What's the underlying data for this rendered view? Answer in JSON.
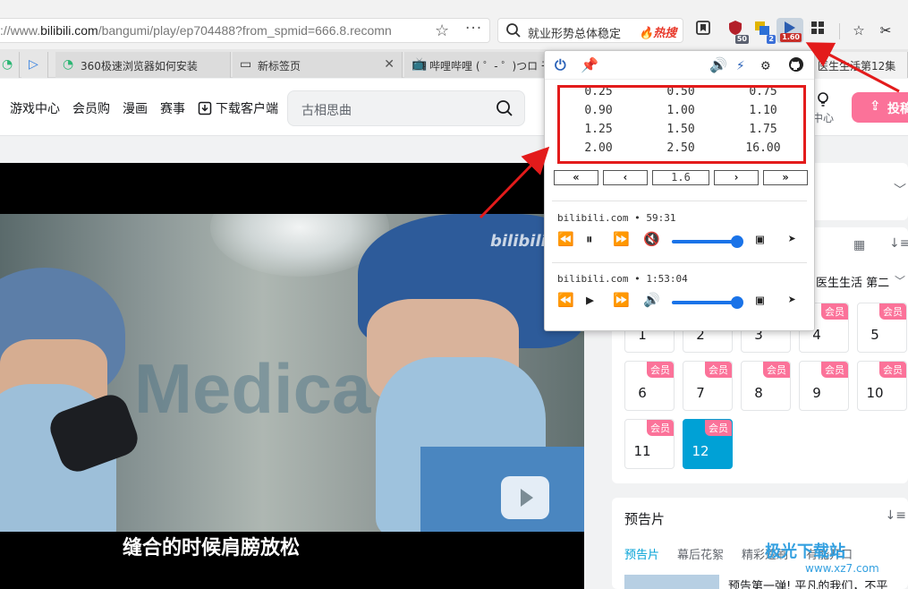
{
  "browser": {
    "url_prefix": "://www.",
    "url_domain": "bilibili.com",
    "url_path": "/bangumi/play/ep704488?from_spmid=666.8.recomn",
    "search_text": "就业形势总体稳定",
    "search_hot": "热搜",
    "badges": {
      "shield": "50",
      "translate": "2",
      "speed": "1.60"
    }
  },
  "tabs": [
    {
      "label": "360极速浏览器如何安装"
    },
    {
      "label": "新标签页"
    },
    {
      "label": "哔哩哔哩 ( ゜- ゜)つロ 干"
    },
    {
      "label": "医生生活第12集"
    }
  ],
  "site_header": {
    "nav": [
      "游戏中心",
      "会员购",
      "漫画",
      "赛事",
      "下载客户端"
    ],
    "search_placeholder": "古相思曲",
    "center_label": "中心",
    "upload_label": "投稿"
  },
  "player": {
    "watermark": "bilibili",
    "scene_text": "Medica",
    "subtitle": "缝合的时候肩膀放松"
  },
  "popup": {
    "speeds": [
      [
        "0.25",
        "0.50",
        "0.75"
      ],
      [
        "0.90",
        "1.00",
        "1.10"
      ],
      [
        "1.25",
        "1.50",
        "1.75"
      ],
      [
        "2.00",
        "2.50",
        "16.00"
      ]
    ],
    "controls": {
      "first": "«",
      "prev": "‹",
      "value": "1.6",
      "next": "›",
      "last": "»"
    },
    "media": [
      {
        "site": "bilibili.com",
        "sep": "•",
        "time": "59:31",
        "state": "playing",
        "volume": 1.0,
        "muted": true
      },
      {
        "site": "bilibili.com",
        "sep": "•",
        "time": "1:53:04",
        "state": "paused",
        "volume": 1.0,
        "muted": false
      }
    ]
  },
  "episodes": {
    "playlist_title": "医生生活 第二",
    "vip_label": "会员",
    "items": [
      "4",
      "5",
      "6",
      "7",
      "8",
      "9",
      "10",
      "11",
      "12"
    ],
    "active": "12"
  },
  "trailer": {
    "title": "预告片",
    "tabs": [
      "预告片",
      "幕后花絮",
      "精彩速刷",
      "有能开口"
    ],
    "first_item": "预告第一弹! 平凡的我们，不平"
  },
  "site_watermark": {
    "main": "极光下载站",
    "sub": "www.xz7.com"
  },
  "colors": {
    "bili_pink": "#fb7299",
    "bili_blue": "#00a1d6",
    "annotation_red": "#e31b1b"
  }
}
